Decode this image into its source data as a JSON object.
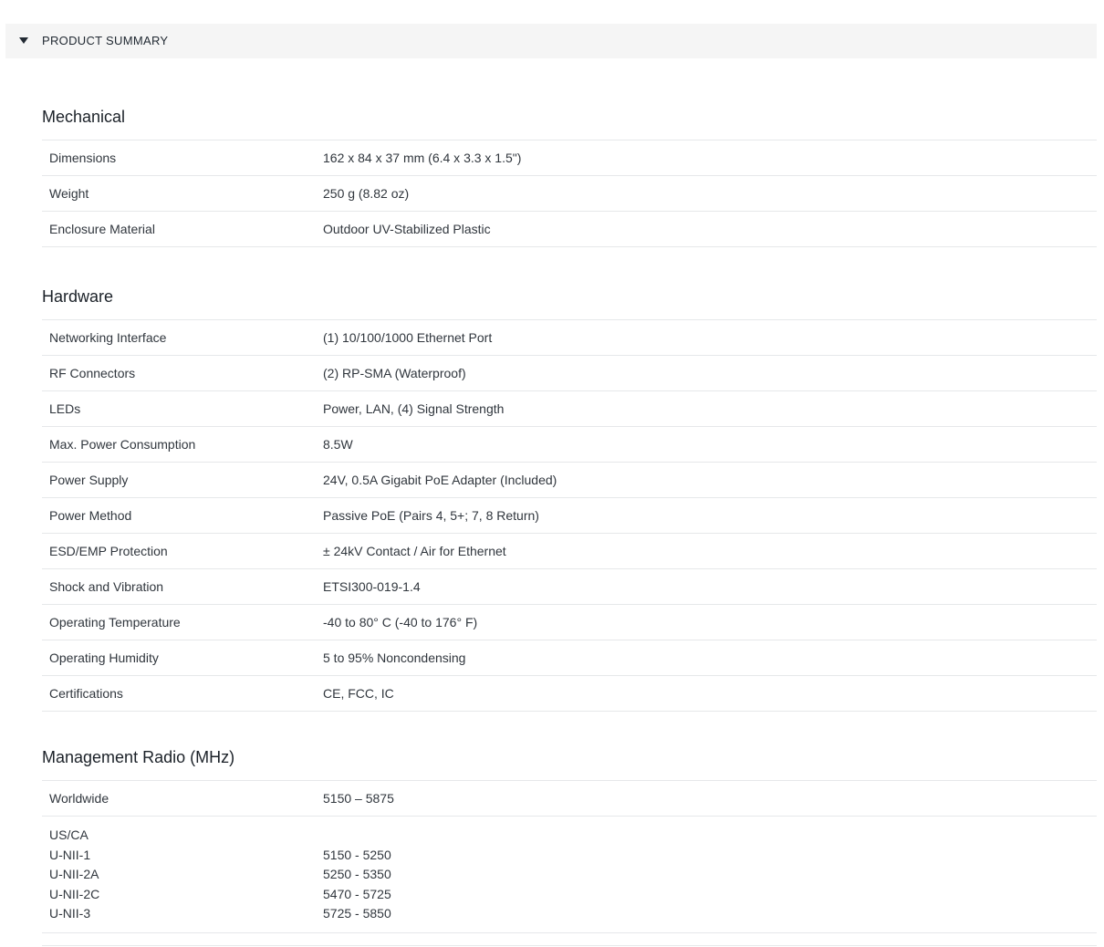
{
  "summary": {
    "label": "PRODUCT SUMMARY"
  },
  "mechanical": {
    "title": "Mechanical",
    "rows": [
      {
        "label": "Dimensions",
        "value": "162 x 84 x 37 mm (6.4 x 3.3 x 1.5\")"
      },
      {
        "label": "Weight",
        "value": "250 g (8.82 oz)"
      },
      {
        "label": "Enclosure Material",
        "value": "Outdoor UV-Stabilized Plastic"
      }
    ]
  },
  "hardware": {
    "title": "Hardware",
    "rows": [
      {
        "label": "Networking Interface",
        "value": "(1) 10/100/1000 Ethernet Port"
      },
      {
        "label": "RF Connectors",
        "value": "(2) RP-SMA (Waterproof)"
      },
      {
        "label": "LEDs",
        "value": "Power, LAN, (4) Signal Strength"
      },
      {
        "label": "Max. Power Consumption",
        "value": "8.5W"
      },
      {
        "label": "Power Supply",
        "value": "24V, 0.5A Gigabit PoE Adapter (Included)"
      },
      {
        "label": "Power Method",
        "value": "Passive PoE (Pairs 4, 5+; 7, 8 Return)"
      },
      {
        "label": "ESD/EMP Protection",
        "value": "± 24kV Contact / Air for Ethernet"
      },
      {
        "label": "Shock and Vibration",
        "value": "ETSI300-019-1.4"
      },
      {
        "label": "Operating Temperature",
        "value": "-40 to 80° C (-40 to 176° F)"
      },
      {
        "label": "Operating Humidity",
        "value": "5 to 95% Noncondensing"
      },
      {
        "label": "Certifications",
        "value": "CE, FCC, IC"
      }
    ]
  },
  "radio": {
    "title": "Management Radio (MHz)",
    "worldwide": {
      "label": "Worldwide",
      "value": "5150 – 5875"
    },
    "usca": {
      "labels": [
        "US/CA",
        "U-NII-1",
        "U-NII-2A",
        "U-NII-2C",
        "U-NII-3"
      ],
      "values": [
        "",
        "5150 - 5250",
        "5250 - 5350",
        "5470 - 5725",
        "5725 - 5850"
      ]
    }
  }
}
